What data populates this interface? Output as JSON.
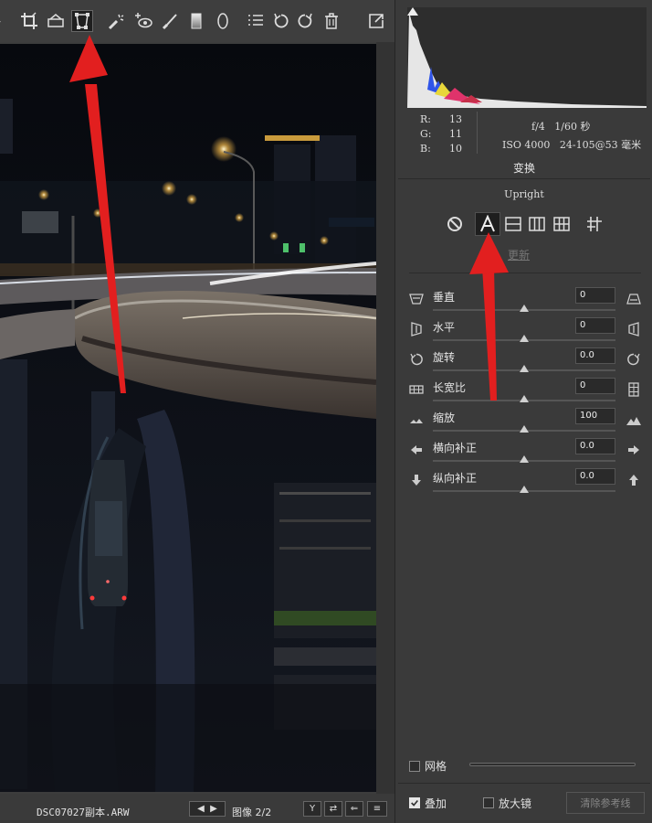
{
  "toolbar": {
    "tools": [
      {
        "name": "white-balance-tool",
        "icon": "dropper-icon"
      },
      {
        "name": "crop-tool",
        "icon": "crop-icon"
      },
      {
        "name": "straighten-tool",
        "icon": "level-icon"
      },
      {
        "name": "transform-tool",
        "icon": "transform-icon",
        "active": true
      },
      {
        "name": "spot-removal-tool",
        "icon": "brush-sparkle-icon"
      },
      {
        "name": "red-eye-tool",
        "icon": "eye-icon"
      },
      {
        "name": "adjustment-brush-tool",
        "icon": "brush-icon"
      },
      {
        "name": "graduated-filter-tool",
        "icon": "gradient-icon"
      },
      {
        "name": "radial-filter-tool",
        "icon": "ellipse-icon"
      },
      {
        "name": "preferences",
        "icon": "list-icon"
      },
      {
        "name": "rotate-left",
        "icon": "rotate-ccw-icon"
      },
      {
        "name": "rotate-right",
        "icon": "rotate-cw-icon"
      },
      {
        "name": "delete",
        "icon": "trash-icon"
      },
      {
        "name": "toggle-fullscreen",
        "icon": "export-icon"
      }
    ]
  },
  "status_bar": {
    "filename": "DSC07027副本.ARW",
    "image_counter": "图像 2/2",
    "buttons": [
      "Y",
      "⇄",
      "⇐",
      "≡"
    ]
  },
  "histogram": {
    "rgb": {
      "r_label": "R:",
      "r": "13",
      "g_label": "G:",
      "g": "11",
      "b_label": "B:",
      "b": "10"
    },
    "exposure": "f/4   1/60 秒",
    "iso_lens": "ISO 4000   24-105@53 毫米"
  },
  "transform_panel": {
    "title": "变换",
    "upright_label": "Upright",
    "update_label": "更新",
    "upright_modes": [
      {
        "name": "upright-off",
        "icon": "no-icon"
      },
      {
        "name": "upright-auto",
        "icon": "letter-a-icon",
        "active": true
      },
      {
        "name": "upright-level",
        "icon": "level-rect-icon"
      },
      {
        "name": "upright-vertical",
        "icon": "vertical-rect-icon"
      },
      {
        "name": "upright-full",
        "icon": "grid-rect-icon"
      },
      {
        "name": "upright-guided",
        "icon": "guided-icon"
      }
    ],
    "sliders": [
      {
        "key": "vertical",
        "label": "垂直",
        "value": "0",
        "position": 0.5
      },
      {
        "key": "horizontal",
        "label": "水平",
        "value": "0",
        "position": 0.5
      },
      {
        "key": "rotate",
        "label": "旋转",
        "value": "0.0",
        "position": 0.5
      },
      {
        "key": "aspect",
        "label": "长宽比",
        "value": "0",
        "position": 0.5
      },
      {
        "key": "scale",
        "label": "缩放",
        "value": "100",
        "position": 0.5
      },
      {
        "key": "x-offset",
        "label": "横向补正",
        "value": "0.0",
        "position": 0.5
      },
      {
        "key": "y-offset",
        "label": "纵向补正",
        "value": "0.0",
        "position": 0.5
      }
    ],
    "grid_label": "网格",
    "overlay_label": "叠加",
    "loupe_label": "放大镜",
    "clear_guides_label": "清除参考线"
  },
  "colors": {
    "annotation_arrow": "#e21f1f",
    "panel_bg": "#3a3a3a",
    "photo_bg": "#0d0f14"
  }
}
